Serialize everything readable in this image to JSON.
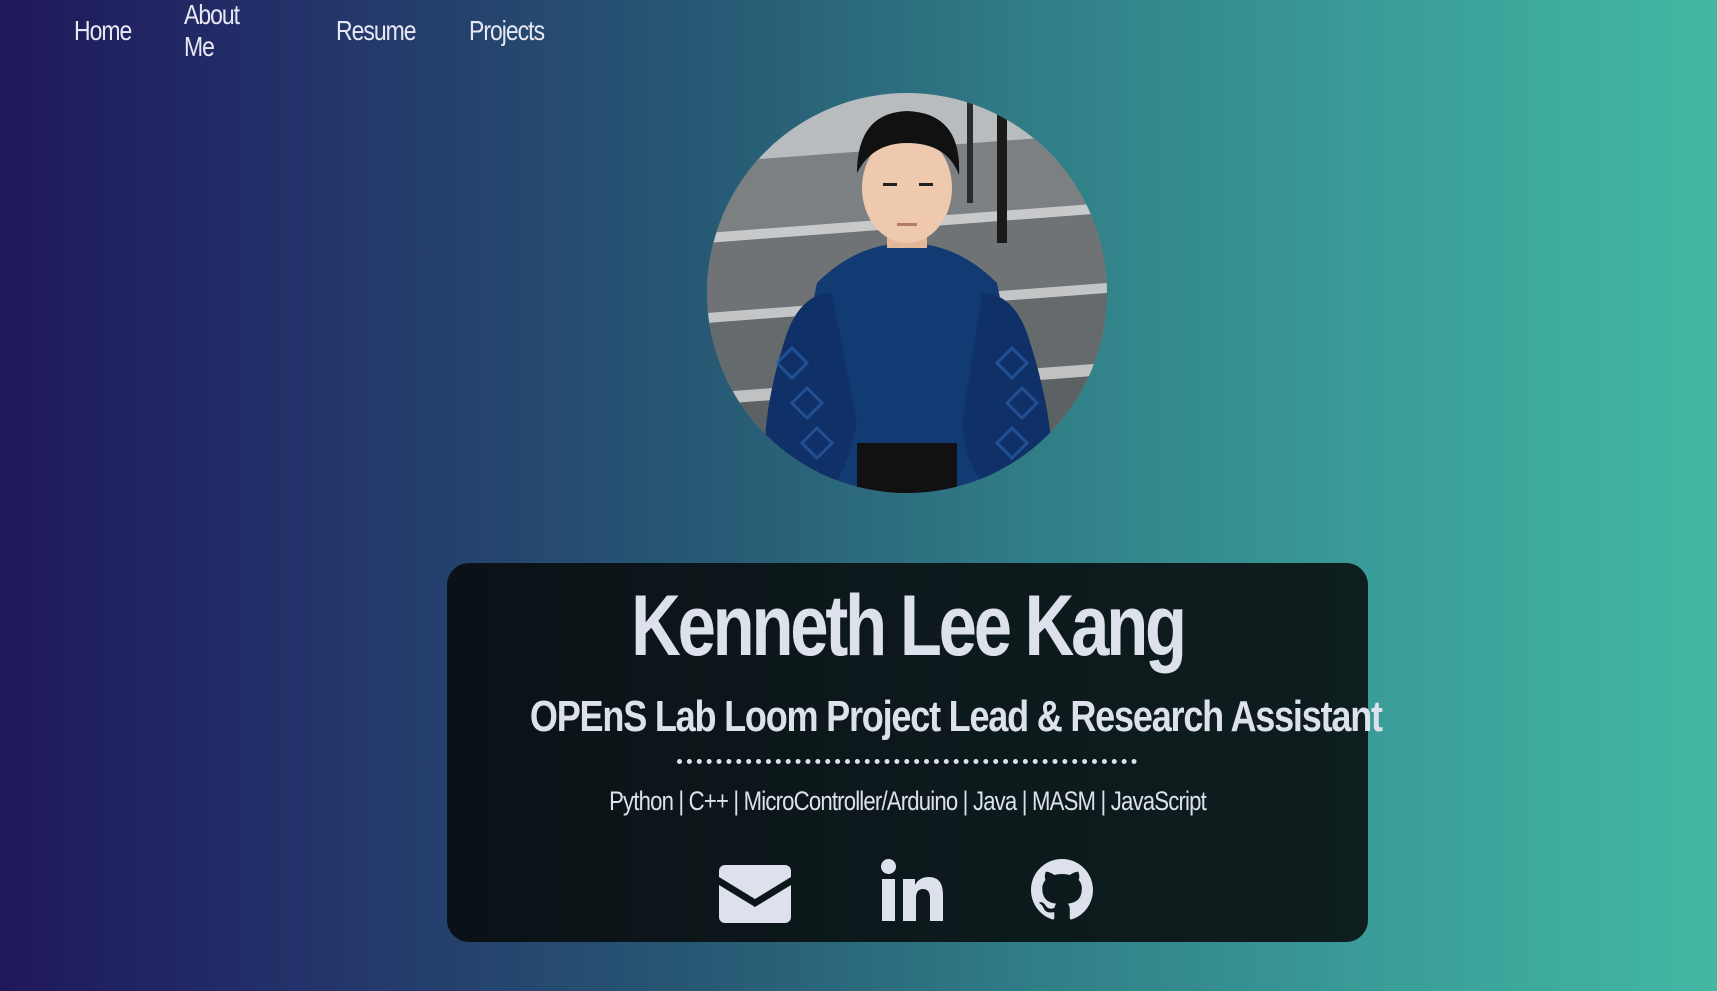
{
  "nav": {
    "items": [
      {
        "label": "Home"
      },
      {
        "label": "About Me"
      },
      {
        "label": "Resume"
      },
      {
        "label": "Projects"
      }
    ]
  },
  "profile": {
    "photo_icon": "profile-photo",
    "name": "Kenneth Lee Kang",
    "title": "OPEnS Lab Loom Project Lead & Research Assistant",
    "skills": "Python | C++ | MicroController/Arduino | Java | MASM | JavaScript"
  },
  "socials": [
    {
      "icon": "envelope-icon"
    },
    {
      "icon": "linkedin-icon"
    },
    {
      "icon": "github-icon"
    }
  ],
  "colors": {
    "gradient_start": "#1f1859",
    "gradient_end": "#42b8a3",
    "card_bg": "#0b1217",
    "text": "#dde1ec"
  }
}
